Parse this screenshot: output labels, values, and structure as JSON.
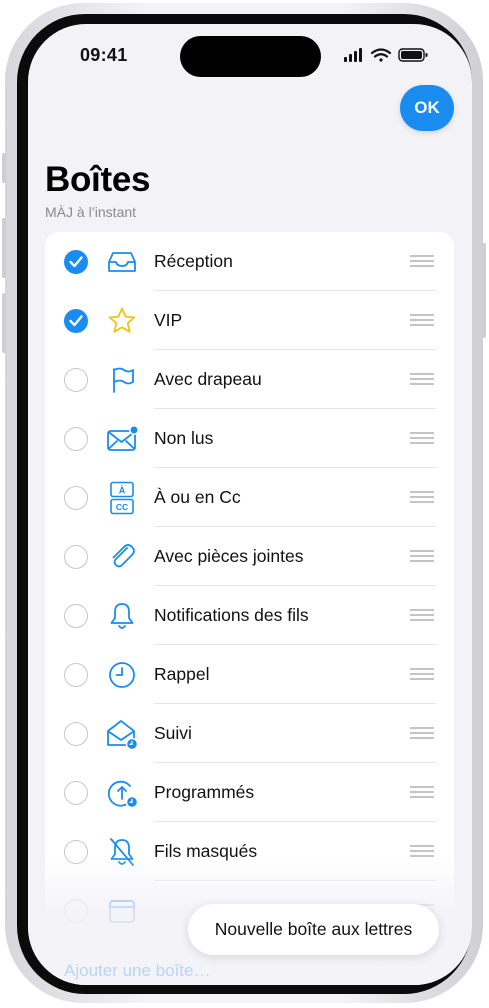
{
  "status_bar": {
    "time": "09:41"
  },
  "toolbar": {
    "ok_label": "OK"
  },
  "header": {
    "title": "Boîtes",
    "subtitle": "MÀJ à l’instant"
  },
  "mailboxes": [
    {
      "label": "Réception",
      "selected": true,
      "icon": "inbox-tray-icon"
    },
    {
      "label": "VIP",
      "selected": true,
      "icon": "star-icon"
    },
    {
      "label": "Avec drapeau",
      "selected": false,
      "icon": "flag-icon"
    },
    {
      "label": "Non lus",
      "selected": false,
      "icon": "unread-envelope-icon"
    },
    {
      "label": "À ou en Cc",
      "selected": false,
      "icon": "to-cc-icon"
    },
    {
      "label": "Avec pièces jointes",
      "selected": false,
      "icon": "paperclip-icon"
    },
    {
      "label": "Notifications des fils",
      "selected": false,
      "icon": "bell-icon"
    },
    {
      "label": "Rappel",
      "selected": false,
      "icon": "clock-icon"
    },
    {
      "label": "Suivi",
      "selected": false,
      "icon": "follow-up-envelope-icon"
    },
    {
      "label": "Programmés",
      "selected": false,
      "icon": "scheduled-clock-icon"
    },
    {
      "label": "Fils masqués",
      "selected": false,
      "icon": "bell-slash-icon"
    },
    {
      "label": "",
      "selected": false,
      "icon": "calendar-icon"
    }
  ],
  "footer": {
    "add_mailbox_label": "Ajouter une boîte…",
    "new_mailbox_label": "Nouvelle boîte aux lettres"
  },
  "colors": {
    "accent": "#1a8cf0",
    "star": "#f0c419",
    "background": "#f2f2f7"
  }
}
